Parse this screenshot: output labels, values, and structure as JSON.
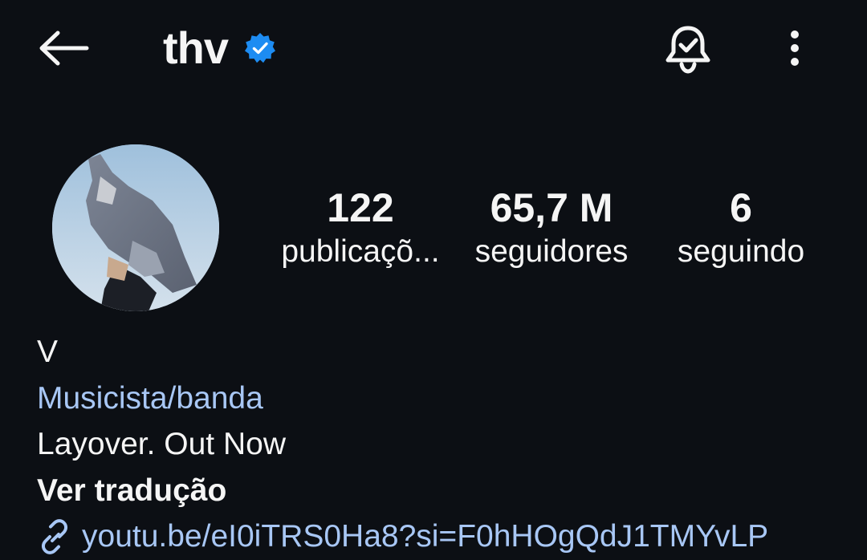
{
  "header": {
    "username": "thv",
    "icons": {
      "back": "arrow-left-icon",
      "verified": "verified-badge-icon",
      "notifications": "bell-check-icon",
      "more": "more-vertical-icon"
    }
  },
  "stats": {
    "posts": {
      "count": "122",
      "label": "publicaçõ..."
    },
    "followers": {
      "count": "65,7 M",
      "label": "seguidores"
    },
    "following": {
      "count": "6",
      "label": "seguindo"
    }
  },
  "bio": {
    "name": "V",
    "category": "Musicista/banda",
    "text": "Layover. Out Now",
    "translate": "Ver tradução",
    "link": "youtu.be/eI0iTRS0Ha8?si=F0hHOgQdJ1TMYvLP",
    "link_icon": "link-icon"
  },
  "colors": {
    "background": "#0c0f14",
    "text": "#f5f5f5",
    "link": "#a8c7f5",
    "verified": "#1d8cf2"
  }
}
